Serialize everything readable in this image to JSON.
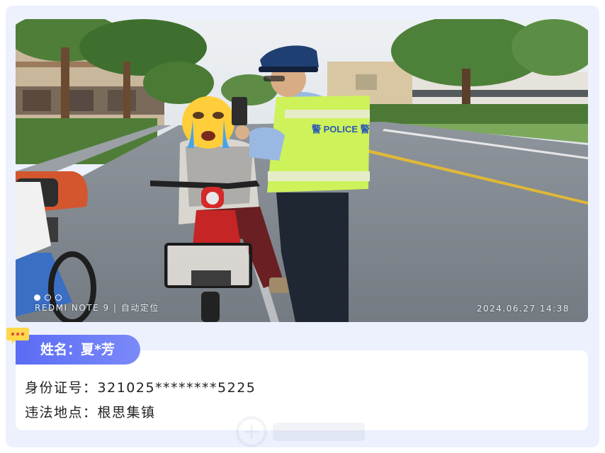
{
  "photo": {
    "caption_left": "REDMI NOTE 9 | 自动定位",
    "caption_right": "2024.06.27  14:38",
    "vest_text": "警 POLICE 警",
    "page_dots": 3,
    "active_dot": 0
  },
  "card": {
    "name_label": "姓名：夏*芳",
    "id_label": "身份证号：",
    "id_value": "321025********5225",
    "location_label": "违法地点：",
    "location_value": "根思集镇"
  },
  "colors": {
    "panel_bg": "#edf0fd",
    "tab_start": "#5b6cf5",
    "tab_end": "#7a8af9",
    "badge": "#ffd84a",
    "text": "#222222"
  },
  "icons": [
    "chat-bubble-icon",
    "crying-emoji-icon",
    "watermark-logo-icon"
  ]
}
